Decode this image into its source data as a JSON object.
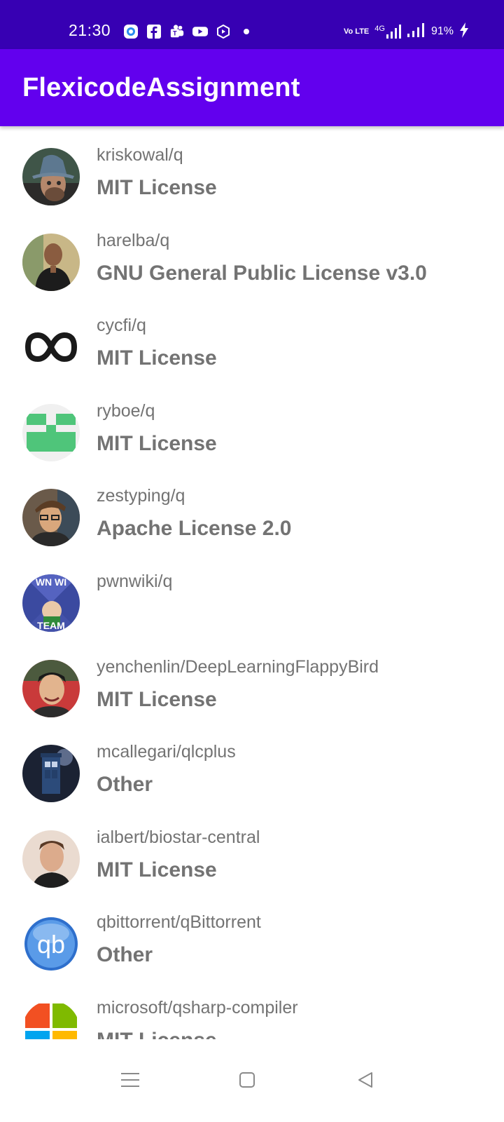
{
  "status_bar": {
    "time": "21:30",
    "network_label": "Vo LTE",
    "network_type": "4G",
    "battery": "91%",
    "icons": [
      "signal-app-icon",
      "facebook-icon",
      "teams-icon",
      "youtube-icon",
      "hexagon-app-icon",
      "dot-icon",
      "volte-icon",
      "4g-signal-icon",
      "signal-icon",
      "battery-charging-icon"
    ]
  },
  "app_bar": {
    "title": "FlexicodeAssignment",
    "color": "#6200ee",
    "status_color": "#3700b3"
  },
  "repos": [
    {
      "name": "kriskowal/q",
      "license": "MIT License",
      "avatar": "photo"
    },
    {
      "name": "harelba/q",
      "license": "GNU General Public License v3.0",
      "avatar": "photo"
    },
    {
      "name": "cycfi/q",
      "license": "MIT License",
      "avatar": "infinity-logo"
    },
    {
      "name": "ryboe/q",
      "license": "MIT License",
      "avatar": "green-identicon"
    },
    {
      "name": "zestyping/q",
      "license": "Apache License 2.0",
      "avatar": "photo"
    },
    {
      "name": "pwnwiki/q",
      "license": "",
      "avatar": "meme-logo",
      "avatar_text_top": "WN WI",
      "avatar_text_bottom": "TEAM"
    },
    {
      "name": "yenchenlin/DeepLearningFlappyBird",
      "license": "MIT License",
      "avatar": "photo"
    },
    {
      "name": "mcallegari/qlcplus",
      "license": "Other",
      "avatar": "tardis-photo"
    },
    {
      "name": "ialbert/biostar-central",
      "license": "MIT License",
      "avatar": "photo"
    },
    {
      "name": "qbittorrent/qBittorrent",
      "license": "Other",
      "avatar": "qb-logo",
      "avatar_text": "qb"
    },
    {
      "name": "microsoft/qsharp-compiler",
      "license": "MIT License",
      "avatar": "microsoft-logo"
    }
  ],
  "nav_bar": {
    "buttons": [
      "menu-icon",
      "home-icon",
      "back-icon"
    ]
  }
}
